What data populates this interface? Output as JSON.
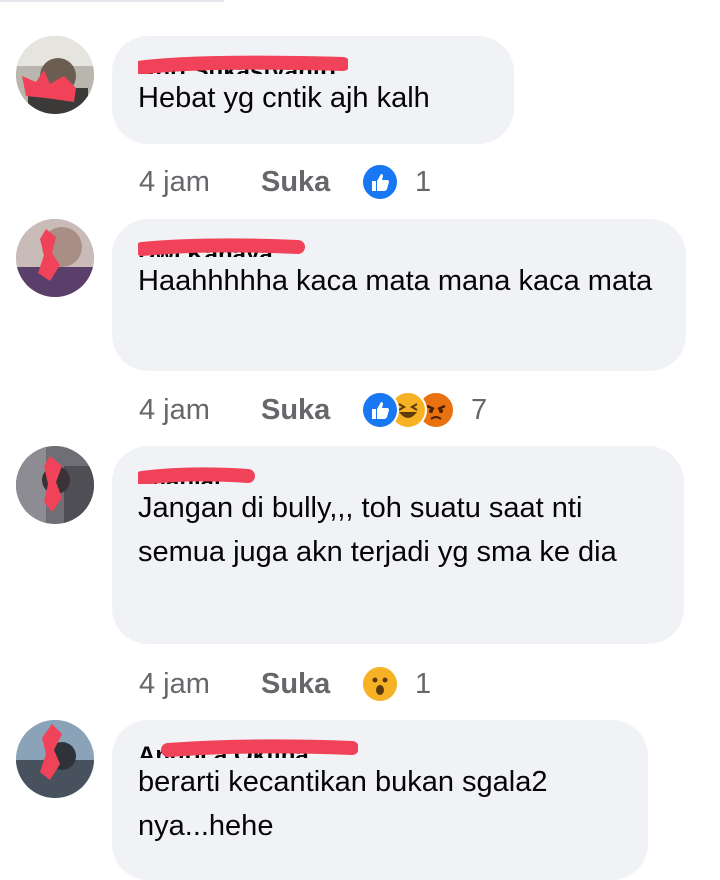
{
  "comments": [
    {
      "author": "Anri Sukastyanto",
      "text": "Hebat yg cntik ajh kalh",
      "time": "4 jam",
      "like_label": "Suka",
      "reactions": [
        "like"
      ],
      "reaction_count": "1"
    },
    {
      "author": "Dwi Kanaya",
      "text": "Haahhhhha kaca mata mana kaca mata",
      "time": "4 jam",
      "like_label": "Suka",
      "reactions": [
        "like",
        "haha",
        "angry"
      ],
      "reaction_count": "7"
    },
    {
      "author": "Imaniar",
      "text": "Jangan di bully,,, toh suatu saat nti semua juga akn terjadi yg sma ke dia",
      "time": "4 jam",
      "like_label": "Suka",
      "reactions": [
        "wow"
      ],
      "reaction_count": "1"
    },
    {
      "author": "Andrica Okfina",
      "text": "berarti kecantikan bukan sgala2 nya...hehe"
    }
  ],
  "colors": {
    "bubble": "#f0f2f5",
    "meta_text": "#65676b",
    "like_blue": "#1877f2",
    "haha_yellow": "#f7b125",
    "angry_orange": "#e9710f",
    "redaction_red": "#f0435a"
  }
}
